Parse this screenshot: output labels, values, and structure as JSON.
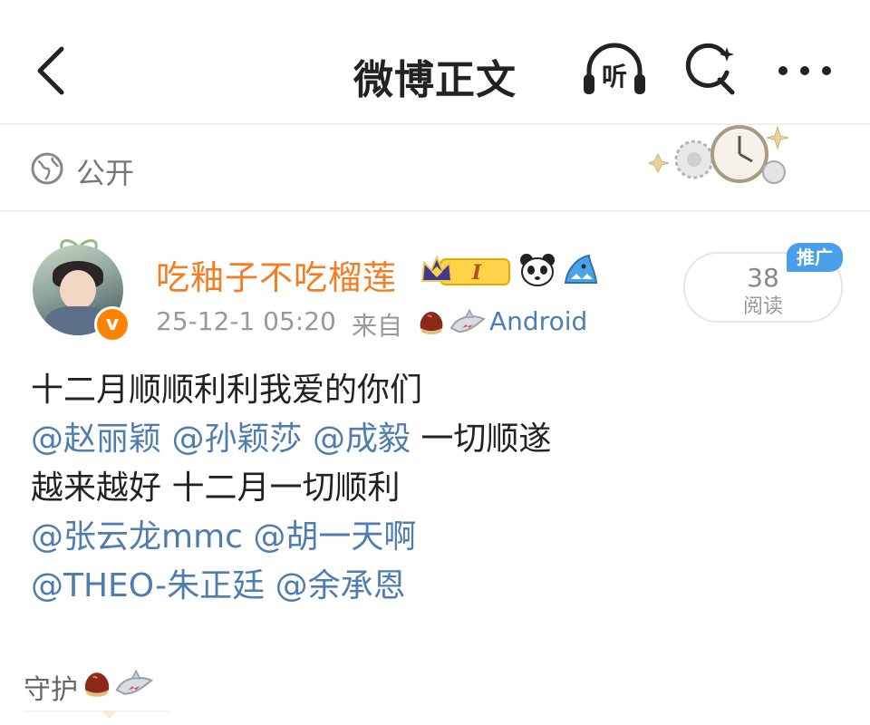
{
  "header": {
    "title": "微博正文",
    "listen_label": "听"
  },
  "visibility": {
    "label": "公开"
  },
  "author": {
    "name": "吃釉子不吃榴莲",
    "vip_badge_text": "I",
    "verified_mark": "v"
  },
  "post_meta": {
    "time": "25-12-1 05:20",
    "from_label": "来自",
    "source": "Android"
  },
  "read_stats": {
    "count": "38",
    "label": "阅读",
    "promo": "推广"
  },
  "post": {
    "lines": [
      {
        "text": "十二月顺顺利利我爱的你们"
      },
      {
        "mentions": [
          "@赵丽颖",
          "@孙颖莎",
          "@成毅"
        ],
        "tail": "一切顺遂"
      },
      {
        "text": "越来越好 十二月一切顺利"
      },
      {
        "mentions": [
          "@张云龙mmc",
          "@胡一天啊"
        ]
      },
      {
        "mentions": [
          "@THEO-朱正廷",
          "@余承恩"
        ]
      }
    ]
  },
  "footer": {
    "guard_label": "守护"
  },
  "colors": {
    "accent_orange": "#f57c21",
    "mention_blue": "#507daf",
    "promo_blue": "#4a9fe8",
    "verified_orange": "#ff8200"
  },
  "icons": [
    "back-arrow-icon",
    "headphones-icon",
    "search-icon",
    "more-icon",
    "globe-icon",
    "crown-icon",
    "panda-icon",
    "shark-icon",
    "chestnut-icon"
  ]
}
